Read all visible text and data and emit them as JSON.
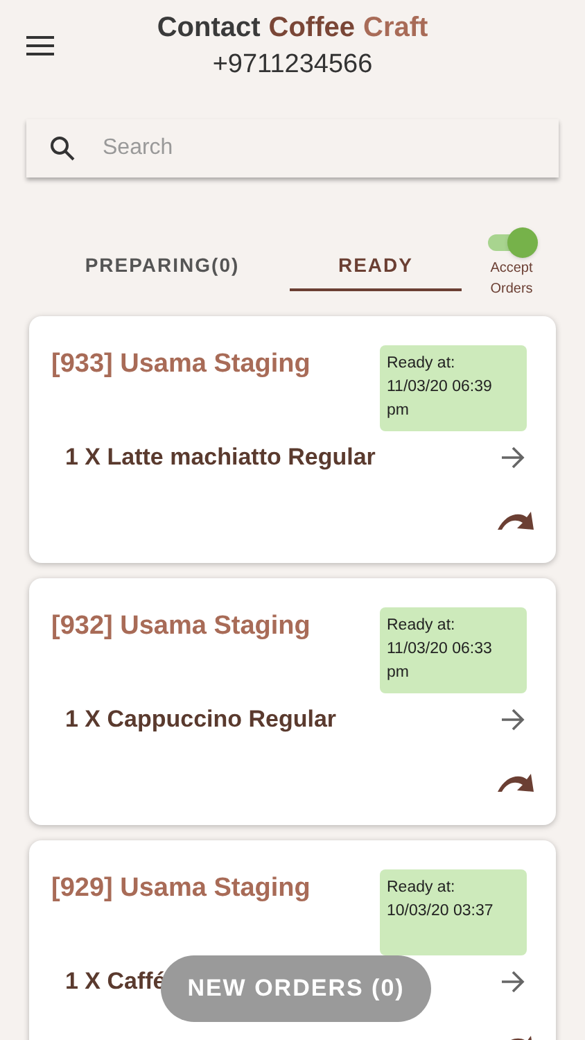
{
  "header": {
    "title_parts": [
      {
        "text": "Contact",
        "color": "#3a3a3a"
      },
      {
        "text": "Coffee",
        "color": "#7a4636"
      },
      {
        "text": "Craft",
        "color": "#a86b57"
      }
    ],
    "phone": "+9711234566"
  },
  "search": {
    "placeholder": "Search"
  },
  "tabs": [
    {
      "label": "PREPARING(0)",
      "selected": false
    },
    {
      "label": "READY",
      "selected": true
    }
  ],
  "accept_orders": {
    "label_lines": [
      "Accept",
      "Orders"
    ],
    "on": true
  },
  "orders": [
    {
      "title": "[933] Usama Staging",
      "ready_at": [
        "Ready at:",
        "11/03/20 06:39",
        "pm"
      ],
      "item": "1 X Latte machiatto Regular"
    },
    {
      "title": "[932] Usama Staging",
      "ready_at": [
        "Ready at:",
        "11/03/20 06:33",
        "pm"
      ],
      "item": "1 X Cappuccino Regular"
    },
    {
      "title": "[929] Usama Staging",
      "ready_at": [
        "Ready at:",
        "10/03/20 03:37"
      ],
      "item": "1 X Caffé"
    }
  ],
  "new_orders_button": "NEW ORDERS (0)"
}
